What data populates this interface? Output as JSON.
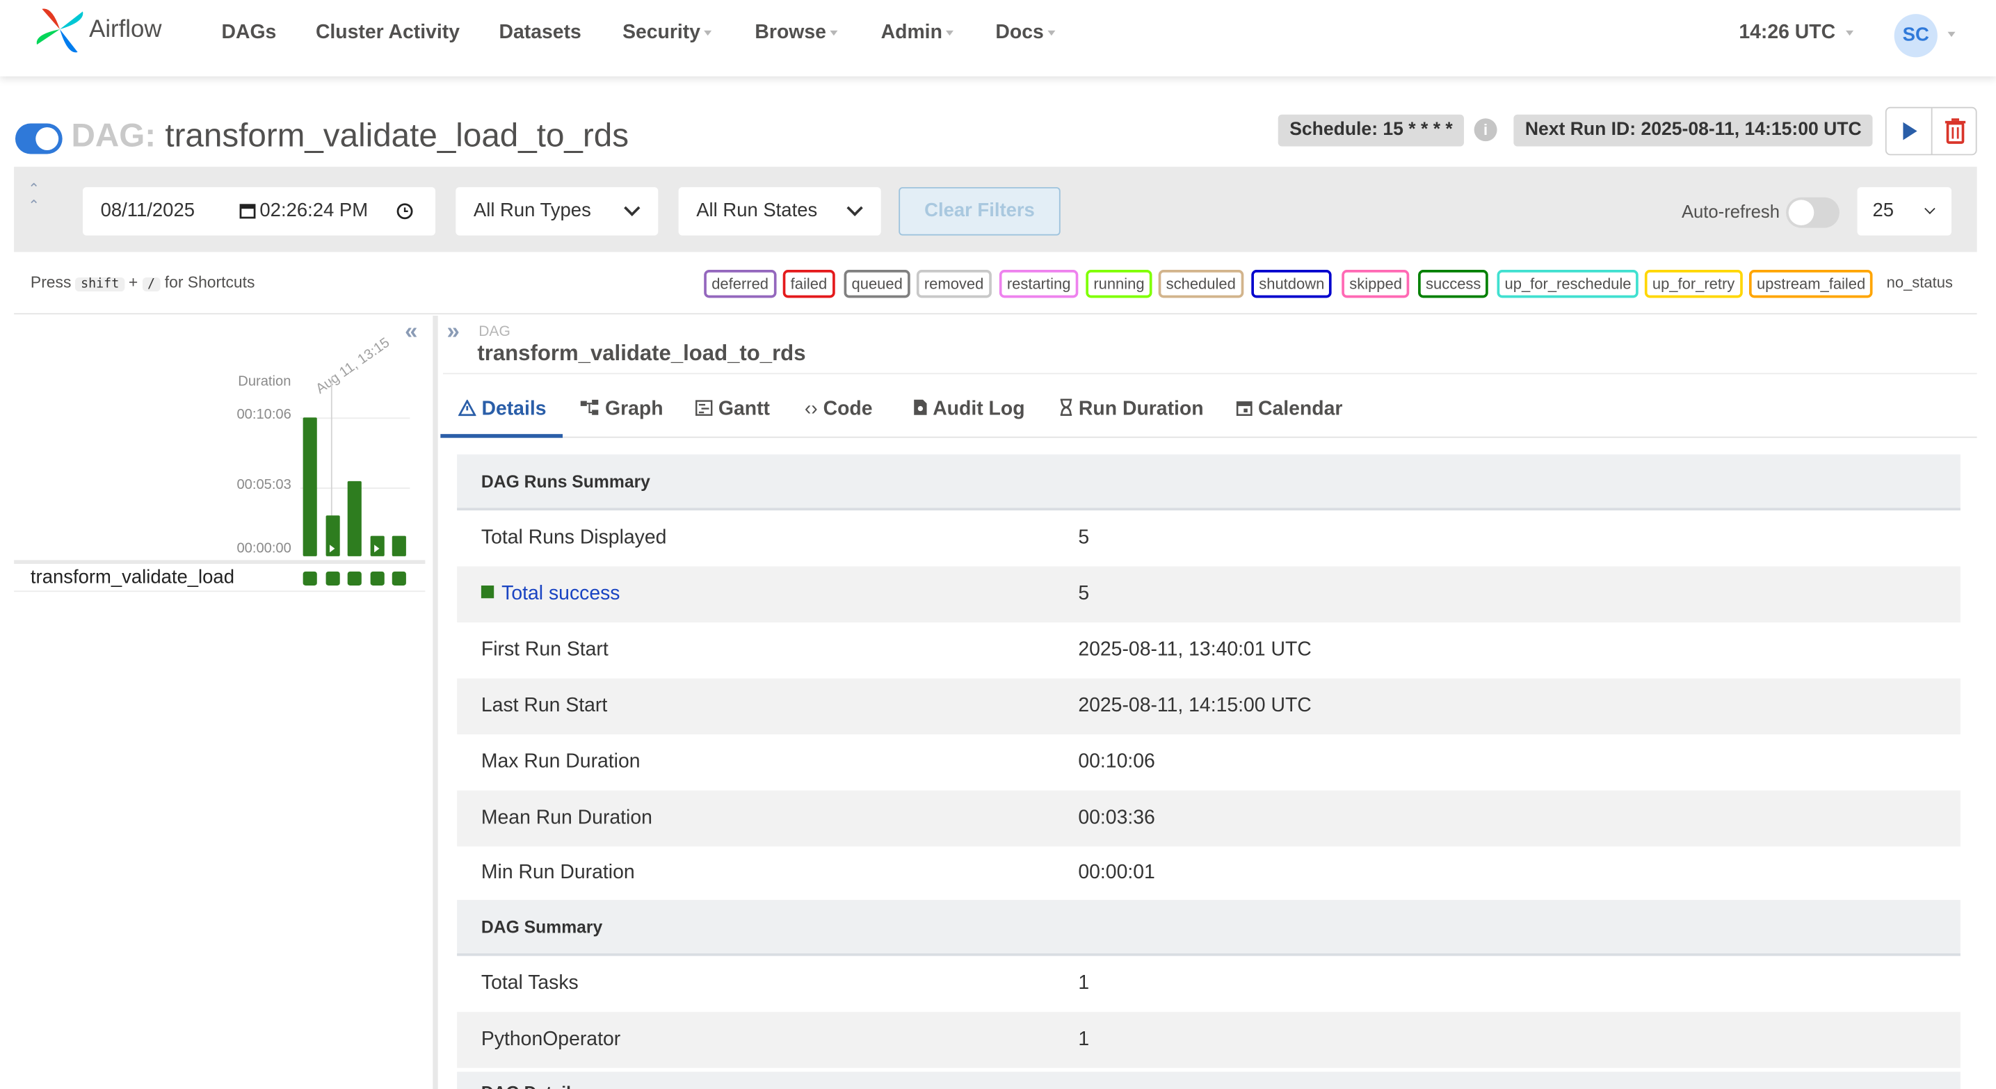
{
  "app": {
    "brand": "Airflow"
  },
  "nav": {
    "items": [
      {
        "label": "DAGs"
      },
      {
        "label": "Cluster Activity"
      },
      {
        "label": "Datasets"
      },
      {
        "label": "Security"
      },
      {
        "label": "Browse"
      },
      {
        "label": "Admin"
      },
      {
        "label": "Docs"
      }
    ],
    "clock": "14:26 UTC",
    "avatar": "SC"
  },
  "dag": {
    "prefix": "DAG:",
    "title": "transform_validate_load_to_rds",
    "schedule": "Schedule: 15 * * * *",
    "next_run": "Next Run ID: 2025-08-11, 14:15:00 UTC"
  },
  "filters": {
    "date": "08/11/2025",
    "time": "02:26:24 PM",
    "run_types": "All Run Types",
    "run_states": "All Run States",
    "clear": "Clear Filters",
    "auto_refresh": "Auto-refresh",
    "page_size": "25"
  },
  "shortcuts": {
    "press": "Press",
    "key1": "shift",
    "plus": "+",
    "key2": "/",
    "suffix": "for Shortcuts"
  },
  "legend": [
    {
      "label": "deferred",
      "color": "#9467bd"
    },
    {
      "label": "failed",
      "color": "#e41a1c"
    },
    {
      "label": "queued",
      "color": "#808080"
    },
    {
      "label": "removed",
      "color": "#c8c8c8"
    },
    {
      "label": "restarting",
      "color": "#ee82ee"
    },
    {
      "label": "running",
      "color": "#7fff00"
    },
    {
      "label": "scheduled",
      "color": "#d2b48c"
    },
    {
      "label": "shutdown",
      "color": "#0000cd"
    },
    {
      "label": "skipped",
      "color": "#ff69b4"
    },
    {
      "label": "success",
      "color": "#008000"
    },
    {
      "label": "up_for_reschedule",
      "color": "#40e0d0"
    },
    {
      "label": "up_for_retry",
      "color": "#ffd700"
    },
    {
      "label": "upstream_failed",
      "color": "#ffa500"
    },
    {
      "label": "no_status",
      "color": ""
    }
  ],
  "grid": {
    "duration_label": "Duration",
    "yticks": [
      "00:10:06",
      "00:05:03",
      "00:00:00"
    ],
    "date_label": "Aug 11, 13:15",
    "run_durations_sec": [
      606,
      180,
      330,
      90,
      90
    ],
    "task_name": "transform_validate_load",
    "task_states": [
      "success",
      "success",
      "success",
      "success",
      "success"
    ]
  },
  "details": {
    "small_label": "DAG",
    "dag_id": "transform_validate_load_to_rds",
    "tabs": [
      {
        "label": "Details",
        "icon": "warning-triangle-icon"
      },
      {
        "label": "Graph",
        "icon": "graph-icon"
      },
      {
        "label": "Gantt",
        "icon": "gantt-icon"
      },
      {
        "label": "Code",
        "icon": "code-icon"
      },
      {
        "label": "Audit Log",
        "icon": "audit-log-icon"
      },
      {
        "label": "Run Duration",
        "icon": "hourglass-icon"
      },
      {
        "label": "Calendar",
        "icon": "calendar-icon"
      }
    ],
    "runs_summary_title": "DAG Runs Summary",
    "runs_summary": [
      {
        "key": "Total Runs Displayed",
        "value": "5"
      },
      {
        "key": "Total success",
        "value": "5"
      },
      {
        "key": "First Run Start",
        "value": "2025-08-11, 13:40:01 UTC"
      },
      {
        "key": "Last Run Start",
        "value": "2025-08-11, 14:15:00 UTC"
      },
      {
        "key": "Max Run Duration",
        "value": "00:10:06"
      },
      {
        "key": "Mean Run Duration",
        "value": "00:03:36"
      },
      {
        "key": "Min Run Duration",
        "value": "00:00:01"
      }
    ],
    "dag_summary_title": "DAG Summary",
    "dag_summary": [
      {
        "key": "Total Tasks",
        "value": "1"
      },
      {
        "key": "PythonOperator",
        "value": "1"
      }
    ],
    "next_section": "DAG Details"
  }
}
